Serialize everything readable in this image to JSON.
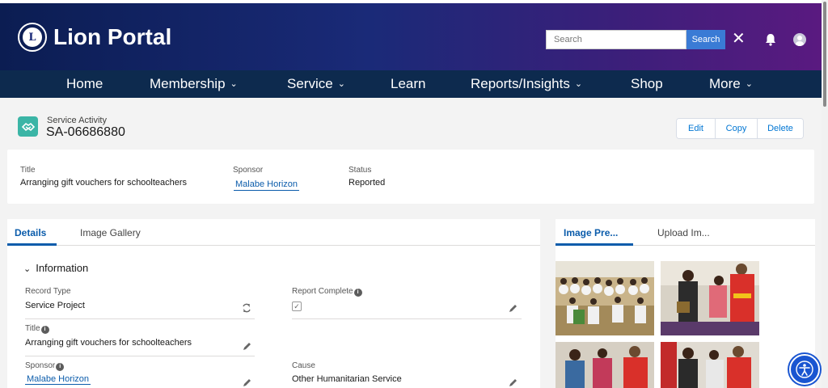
{
  "header": {
    "brand": "Lion Portal",
    "search_placeholder": "Search",
    "search_button": "Search",
    "close_glyph": "✕"
  },
  "nav": [
    {
      "label": "Home",
      "dropdown": false
    },
    {
      "label": "Membership",
      "dropdown": true
    },
    {
      "label": "Service",
      "dropdown": true
    },
    {
      "label": "Learn",
      "dropdown": false
    },
    {
      "label": "Reports/Insights",
      "dropdown": true
    },
    {
      "label": "Shop",
      "dropdown": false
    },
    {
      "label": "More",
      "dropdown": true
    }
  ],
  "record": {
    "object_type": "Service Activity",
    "record_id": "SA-06686880",
    "actions": {
      "edit": "Edit",
      "copy": "Copy",
      "delete": "Delete"
    }
  },
  "highlights": {
    "title_label": "Title",
    "title_value": "Arranging gift vouchers for schoolteachers",
    "sponsor_label": "Sponsor",
    "sponsor_value": "Malabe Horizon",
    "status_label": "Status",
    "status_value": "Reported"
  },
  "details": {
    "tabs": [
      "Details",
      "Image Gallery"
    ],
    "section_title": "Information",
    "fields": {
      "record_type_label": "Record Type",
      "record_type_value": "Service Project",
      "report_complete_label": "Report Complete",
      "title_label": "Title",
      "title_value": "Arranging gift vouchers for schoolteachers",
      "sponsor_label": "Sponsor",
      "sponsor_value": "Malabe Horizon",
      "cause_label": "Cause",
      "cause_value": "Other Humanitarian Service"
    }
  },
  "images_panel": {
    "tabs": [
      "Image Pre...",
      "Upload Im..."
    ]
  },
  "colors": {
    "header_start": "#0b1d52",
    "header_end": "#5a1a80",
    "nav_bg": "#0d2a4e",
    "link": "#0b5cab",
    "record_icon": "#3bb5a6",
    "accessibility": "#1955d1"
  }
}
